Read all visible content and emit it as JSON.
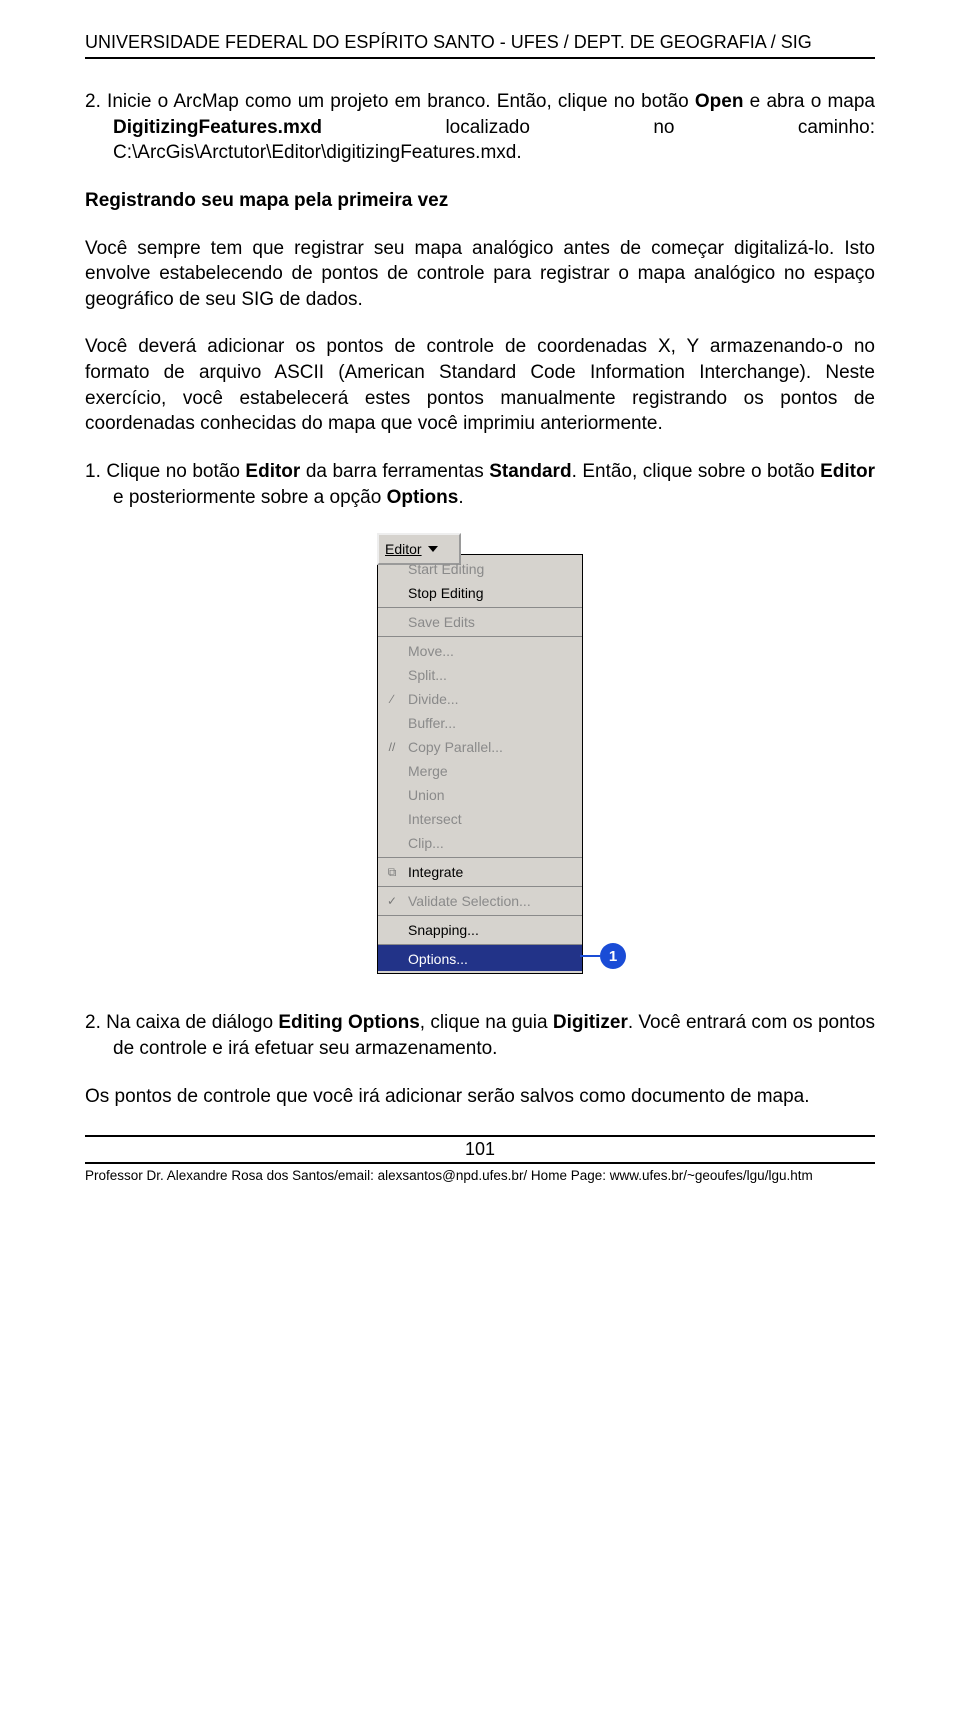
{
  "header": "UNIVERSIDADE FEDERAL DO ESPÍRITO SANTO - UFES / DEPT. DE GEOGRAFIA / SIG",
  "p1_a": "2. Inicie o ArcMap como um projeto em branco. Então, clique no botão ",
  "p1_b": "Open",
  "p1_c": " e abra o mapa ",
  "p1_d": "DigitizingFeatures.mxd",
  "p1_e": " localizado no caminho: C:\\ArcGis\\Arctutor\\Editor\\digitizingFeatures.mxd.",
  "h2": "Registrando seu mapa pela primeira vez",
  "p2": "Você sempre tem que registrar seu mapa analógico antes de começar digitalizá-lo. Isto envolve estabelecendo de pontos de controle para registrar o mapa analógico no espaço geográfico de seu SIG de dados.",
  "p3": "Você deverá adicionar os pontos de controle de coordenadas X, Y armazenando-o no formato de arquivo ASCII (American Standard Code Information Interchange). Neste exercício, você estabelecerá estes pontos manualmente registrando os pontos de coordenadas conhecidas do mapa que você imprimiu anteriormente.",
  "p4_a": "1. Clique no botão ",
  "p4_b": "Editor",
  "p4_c": " da barra ferramentas ",
  "p4_d": "Standard",
  "p4_e": ". Então, clique sobre o botão ",
  "p4_f": "Editor",
  "p4_g": " e posteriormente sobre a opção ",
  "p4_h": "Options",
  "p4_i": ".",
  "editor_label": "Editor",
  "menu": {
    "items": [
      {
        "label": "Start Editing",
        "disabled": true
      },
      {
        "label": "Stop Editing",
        "disabled": false
      },
      {
        "label": "Save Edits",
        "disabled": true,
        "sep": true
      },
      {
        "label": "Move...",
        "disabled": true,
        "sep": true
      },
      {
        "label": "Split...",
        "disabled": true
      },
      {
        "label": "Divide...",
        "disabled": true,
        "icon": "∕"
      },
      {
        "label": "Buffer...",
        "disabled": true
      },
      {
        "label": "Copy Parallel...",
        "disabled": true,
        "icon": "//"
      },
      {
        "label": "Merge",
        "disabled": true
      },
      {
        "label": "Union",
        "disabled": true
      },
      {
        "label": "Intersect",
        "disabled": true
      },
      {
        "label": "Clip...",
        "disabled": true
      },
      {
        "label": "Integrate",
        "disabled": false,
        "icon": "⧉",
        "sep": true
      },
      {
        "label": "Validate Selection...",
        "disabled": true,
        "icon": "✓",
        "sep": true
      },
      {
        "label": "Snapping...",
        "disabled": false,
        "sep": true
      },
      {
        "label": "Options...",
        "disabled": false,
        "highlight": true,
        "sep": true
      }
    ]
  },
  "callout_num": "1",
  "p5_a": "2. Na caixa de diálogo ",
  "p5_b": "Editing Options",
  "p5_c": ", clique na guia ",
  "p5_d": "Digitizer",
  "p5_e": ". Você entrará com os pontos de controle e irá efetuar seu armazenamento.",
  "p6": "Os pontos de controle que você irá adicionar serão salvos como documento de mapa.",
  "page_number": "101",
  "footer": "Professor Dr. Alexandre Rosa dos Santos/email: alexsantos@npd.ufes.br/ Home Page: www.ufes.br/~geoufes/lgu/lgu.htm"
}
